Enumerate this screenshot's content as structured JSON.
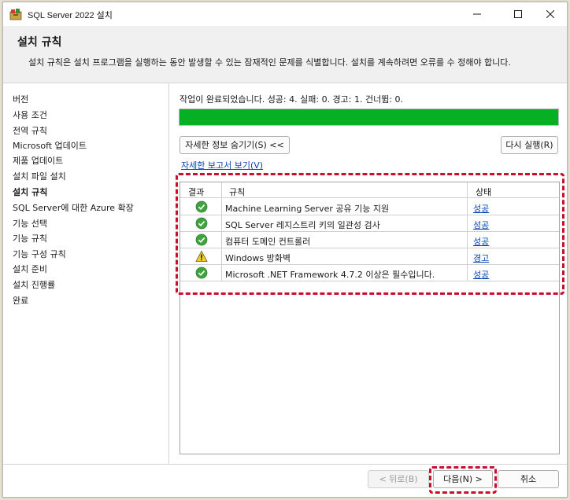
{
  "window": {
    "title": "SQL Server 2022 설치",
    "controls": {
      "minimize": "minimize-icon",
      "maximize": "maximize-icon",
      "close": "close-icon"
    }
  },
  "header": {
    "title": "설치 규칙",
    "description": "설치 규칙은 설치 프로그램을 실행하는 동안 발생할 수 있는 잠재적인 문제를 식별합니다. 설치를 계속하려면 오류를 수 정해야 합니다."
  },
  "sidebar": {
    "items": [
      {
        "label": "버전",
        "active": false
      },
      {
        "label": "사용 조건",
        "active": false
      },
      {
        "label": "전역 규칙",
        "active": false
      },
      {
        "label": "Microsoft 업데이트",
        "active": false
      },
      {
        "label": "제품 업데이트",
        "active": false
      },
      {
        "label": "설치 파일 설치",
        "active": false
      },
      {
        "label": "설치 규칙",
        "active": true
      },
      {
        "label": "SQL Server에 대한 Azure 확장",
        "active": false
      },
      {
        "label": "기능 선택",
        "active": false
      },
      {
        "label": "기능 규칙",
        "active": false
      },
      {
        "label": "기능 구성 규칙",
        "active": false
      },
      {
        "label": "설치 준비",
        "active": false
      },
      {
        "label": "설치 진행률",
        "active": false
      },
      {
        "label": "완료",
        "active": false
      }
    ]
  },
  "main": {
    "status_text": "작업이 완료되었습니다. 성공: 4. 실패: 0. 경고: 1. 건너뜀: 0.",
    "progress_percent": 100,
    "progress_color": "#06b025",
    "hide_details_label": "자세한 정보 숨기기(S) <<",
    "rerun_label": "다시 실행(R)",
    "report_link": "자세한 보고서 보기(V)",
    "table": {
      "headers": {
        "result": "결과",
        "rule": "규칙",
        "status": "상태"
      },
      "rows": [
        {
          "icon": "success-check-icon",
          "rule": "Machine Learning Server 공유 기능 지원",
          "status": "성공"
        },
        {
          "icon": "success-check-icon",
          "rule": "SQL Server 레지스트리 키의 일관성 검사",
          "status": "성공"
        },
        {
          "icon": "success-check-icon",
          "rule": "컴퓨터 도메인 컨트롤러",
          "status": "성공"
        },
        {
          "icon": "warning-icon",
          "rule": "Windows 방화벽",
          "status": "경고"
        },
        {
          "icon": "success-check-icon",
          "rule": "Microsoft .NET Framework 4.7.2 이상은 필수입니다.",
          "status": "성공"
        }
      ]
    },
    "highlight_color": "#c8102e"
  },
  "footer": {
    "back_label": "< 뒤로(B)",
    "next_label": "다음(N) >",
    "cancel_label": "취소"
  }
}
